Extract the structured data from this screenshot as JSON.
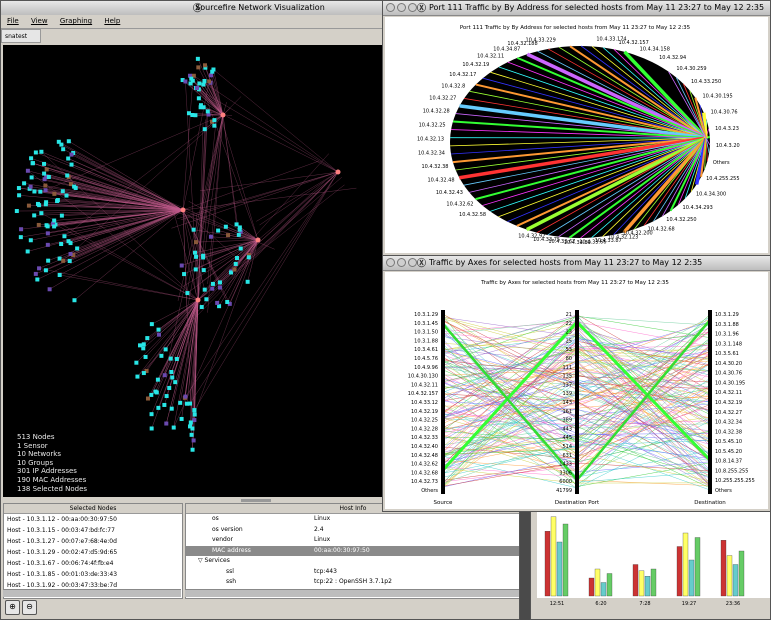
{
  "main_window": {
    "title": "Sourcefire Network Visualization",
    "menu": [
      "File",
      "View",
      "Graphing",
      "Help"
    ],
    "tab": "snatest",
    "stats": [
      "513 Nodes",
      "1 Sensor",
      "10 Networks",
      "10 Groups",
      "301 IP Addresses",
      "190 MAC Addresses",
      "138 Selected Nodes"
    ]
  },
  "pie_window": {
    "title": "Port 111 Traffic by By Address for selected hosts  from May 11 23:27 to May 12 2:35",
    "chart_title": "Port 111 Traffic by By Address for selected hosts  from May 11 23:27 to May 12 2:35",
    "labels_right": [
      "10.4.33.174",
      "10.4.32.157",
      "10.4.34.158",
      "10.4.32.94",
      "10.4.30.259",
      "10.4.33.250",
      "10.4.30.195",
      "10.4.30.76",
      "10.4.3.23",
      "10.4.3.20",
      "Others",
      "10.4.255.255",
      "10.4.34.300",
      "10.4.34.293",
      "10.4.32.250",
      "10.4.32.68"
    ],
    "labels_left": [
      "10.4.33.229",
      "10.4.32.188",
      "10.4.34.87",
      "10.4.32.11",
      "10.4.32.19",
      "10.4.32.17",
      "10.4.32.8",
      "10.4.32.27",
      "10.4.32.28",
      "10.4.32.25",
      "10.4.32.13",
      "10.4.32.34",
      "10.4.32.38",
      "10.4.32.48",
      "10.4.32.43",
      "10.4.32.62",
      "10.4.32.58"
    ],
    "labels_bottom": [
      "10.4.32.92",
      "10.4.33.75",
      "10.4.33.67",
      "10.4.34.80",
      "10.4.33.66",
      "10.4.33.87",
      "10.4.32.123",
      "10.4.32.200"
    ]
  },
  "axes_window": {
    "title": "Traffic by Axes for selected hosts  from May 11 23:27 to May 12 2:35",
    "chart_title": "Traffic by Axes for selected hosts  from May 11 23:27 to May 12 2:35",
    "source_ticks": [
      "10.3.1.29",
      "10.3.1.45",
      "10.3.1.50",
      "10.3.1.88",
      "10.3.4.61",
      "10.4.5.76",
      "10.4.9.96",
      "10.4.30.130",
      "10.4.32.11",
      "10.4.32.157",
      "10.4.33.12",
      "10.4.32.19",
      "10.4.32.25",
      "10.4.32.28",
      "10.4.32.33",
      "10.4.32.40",
      "10.4.32.48",
      "10.4.32.62",
      "10.4.32.68",
      "10.4.32.73",
      "Others"
    ],
    "port_ticks": [
      "21",
      "22",
      "23",
      "25",
      "53",
      "80",
      "111",
      "135",
      "137",
      "139",
      "143",
      "161",
      "389",
      "443",
      "445",
      "514",
      "631",
      "1433",
      "3306",
      "6000",
      "41799"
    ],
    "dest_ticks": [
      "10.3.1.29",
      "10.3.1.88",
      "10.3.1.96",
      "10.3.1.148",
      "10.3.5.61",
      "10.4.30.20",
      "10.4.30.76",
      "10.4.30.195",
      "10.4.32.11",
      "10.4.32.19",
      "10.4.32.27",
      "10.4.32.34",
      "10.4.32.38",
      "10.5.45.10",
      "10.5.45.20",
      "10.8.14.37",
      "10.8.255.255",
      "10.255.255.255",
      "Others"
    ],
    "axis_labels": [
      "Source",
      "Destination Port",
      "Destination"
    ]
  },
  "selected_nodes": {
    "header": "Selected Nodes",
    "items": [
      "Host  - 10.3.1.12 - 00:aa:00:30:97:50",
      "Host  - 10.3.1.15 - 00:03:47:bd:fc:77",
      "Host  - 10.3.1.27 - 00:07:e7:68:4e:0d",
      "Host  - 10.3.1.29 - 00:02:47:d5:9d:65",
      "Host  - 10.3.1.67 - 00:06:74:4f:fb:e4",
      "Host  - 10.3.1.85 - 00:01:03:de:33:43",
      "Host  - 10.3.1.92 - 00:03:47:33:be:7d"
    ]
  },
  "host_info": {
    "header": "Host Info",
    "rows": [
      {
        "k": "os",
        "v": "Linux"
      },
      {
        "k": "os version",
        "v": "2.4"
      },
      {
        "k": "vendor",
        "v": "Linux"
      },
      {
        "k": "MAC address",
        "v": "00:aa:00:30:97:50"
      },
      {
        "k": "▽ Services",
        "v": ""
      },
      {
        "k": "ssl",
        "v": "tcp:443"
      },
      {
        "k": "ssh",
        "v": "tcp:22 : OpenSSH 3.7.1p2"
      }
    ]
  },
  "bar_chart": {
    "x_labels": [
      "12:51",
      "6:20",
      "7:28",
      "19:27",
      "23:36"
    ]
  },
  "chart_data": [
    {
      "type": "pie",
      "title": "Port 111 Traffic by By Address for selected hosts  from May 11 23:27 to May 12 2:35"
    },
    {
      "type": "line",
      "title": "Traffic by Axes for selected hosts  from May 11 23:27 to May 12 2:35",
      "axes": [
        "Source",
        "Destination Port",
        "Destination"
      ]
    },
    {
      "type": "bar",
      "categories": [
        "12:51",
        "6:20",
        "7:28",
        "19:27",
        "23:36"
      ],
      "series": [
        {
          "values": [
            72,
            20,
            35,
            55,
            62
          ]
        },
        {
          "values": [
            88,
            30,
            28,
            70,
            45
          ]
        },
        {
          "values": [
            60,
            15,
            22,
            40,
            35
          ]
        },
        {
          "values": [
            80,
            25,
            30,
            65,
            50
          ]
        }
      ]
    }
  ],
  "colors": {
    "edge": "#c05a8c",
    "node": "#28e6e6",
    "selected_row": "#8a8a8a"
  }
}
